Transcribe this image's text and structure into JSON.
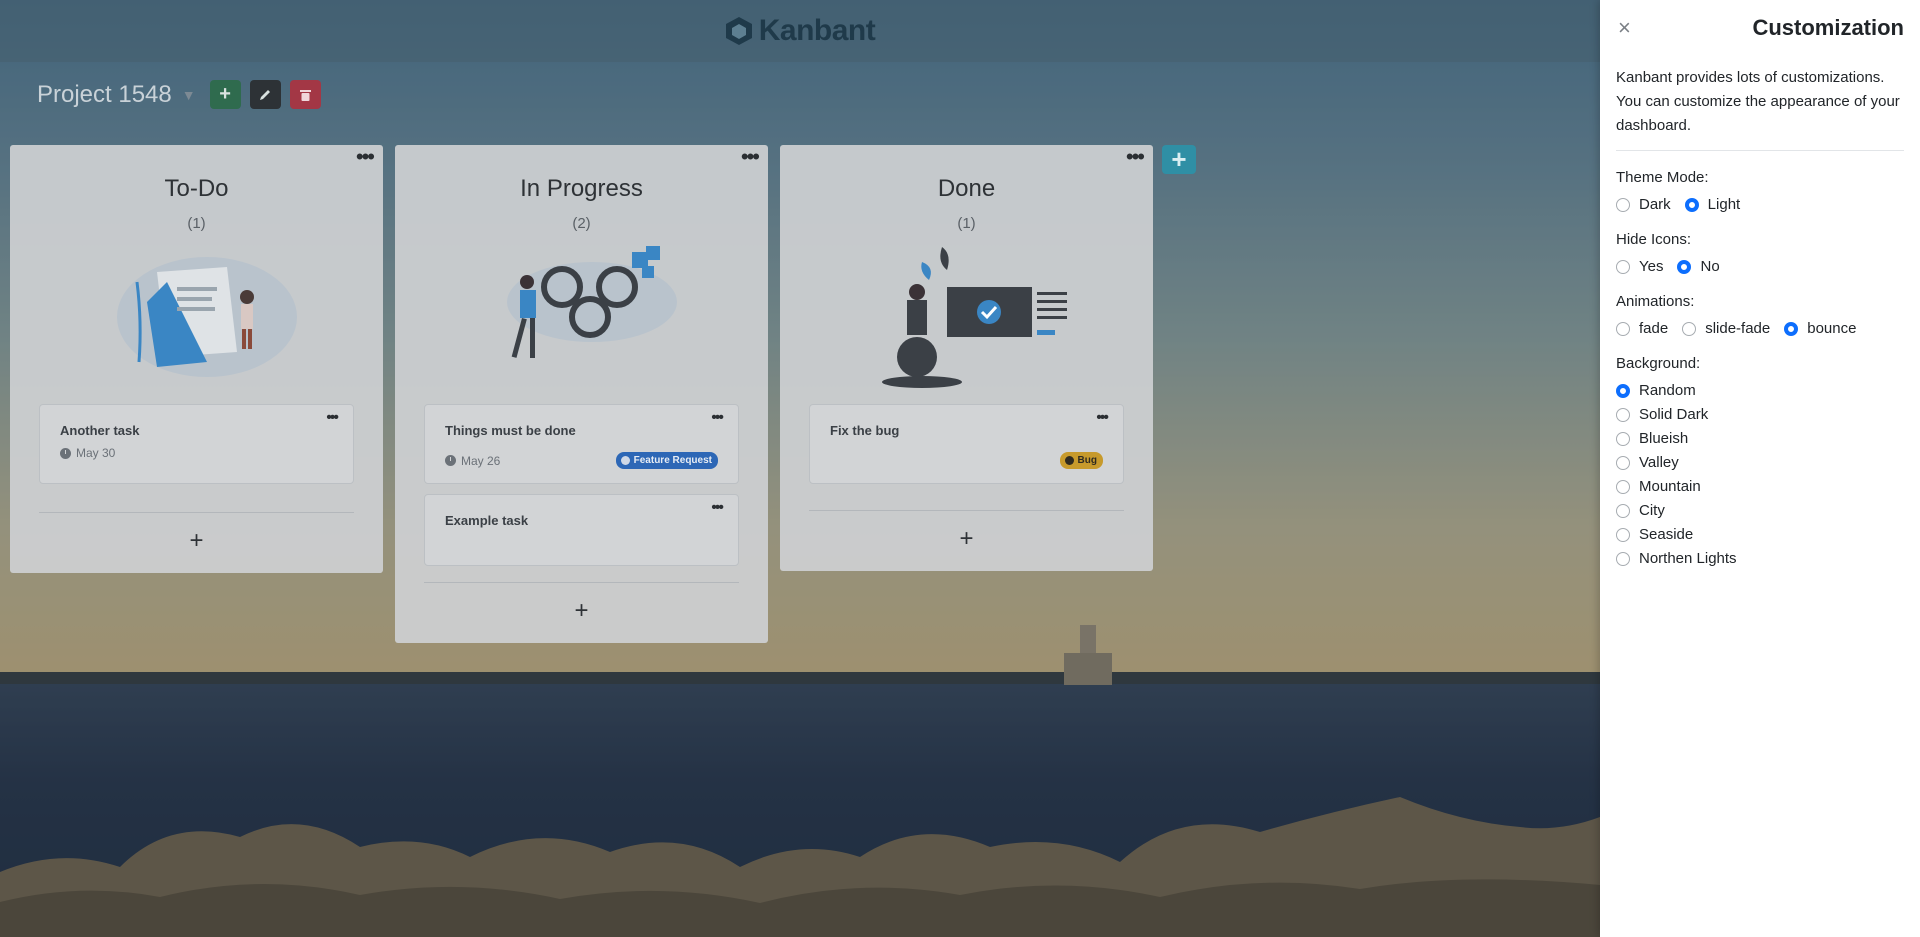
{
  "app": {
    "name": "Kanbant"
  },
  "project": {
    "name": "Project 1548"
  },
  "columns": [
    {
      "title": "To-Do",
      "count": "(1)",
      "cards": [
        {
          "title": "Another task",
          "date": "May 30",
          "badge": ""
        }
      ]
    },
    {
      "title": "In Progress",
      "count": "(2)",
      "cards": [
        {
          "title": "Things must be done",
          "date": "May 26",
          "badge": "Feature Request"
        },
        {
          "title": "Example task",
          "date": "",
          "badge": ""
        }
      ]
    },
    {
      "title": "Done",
      "count": "(1)",
      "cards": [
        {
          "title": "Fix the bug",
          "date": "",
          "badge": "Bug"
        }
      ]
    }
  ],
  "icons": {
    "close": "×",
    "plus": "+",
    "dots": "•••"
  },
  "colors": {
    "accent": "#0d6efd",
    "add_green": "#2f6b4e",
    "delete_red": "#a33745",
    "add_board_teal": "#2f8fa5",
    "feature_badge": "#2d67b6",
    "bug_badge": "#c79a2c"
  },
  "panel": {
    "title": "Customization",
    "description": "Kanbant provides lots of customizations. You can customize the appearance of your dashboard.",
    "theme": {
      "label": "Theme Mode:",
      "options": [
        "Dark",
        "Light"
      ],
      "selected": "Light"
    },
    "hide_icons": {
      "label": "Hide Icons:",
      "options": [
        "Yes",
        "No"
      ],
      "selected": "No"
    },
    "animations": {
      "label": "Animations:",
      "options": [
        "fade",
        "slide-fade",
        "bounce"
      ],
      "selected": "bounce"
    },
    "background": {
      "label": "Background:",
      "options": [
        "Random",
        "Solid Dark",
        "Blueish",
        "Valley",
        "Mountain",
        "City",
        "Seaside",
        "Northen Lights"
      ],
      "selected": "Random"
    }
  }
}
